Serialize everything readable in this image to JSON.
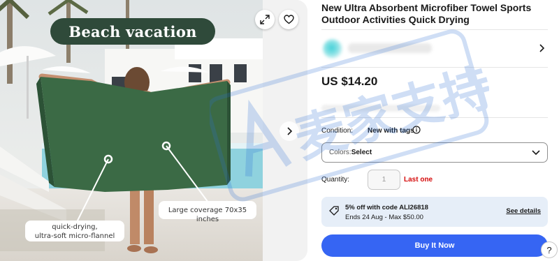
{
  "gallery": {
    "badge_text": "Beach vacation",
    "callouts": [
      "Large coverage 70x35 inches",
      "quick-drying,\nultra-soft micro-flannel"
    ],
    "expand_icon": "expand-icon",
    "favorite_icon": "heart-icon",
    "next_icon": "chevron-right-icon"
  },
  "product": {
    "title": "New Ultra Absorbent Microfiber Towel Sports Outdoor Activities Quick Drying",
    "price": "US $14.20",
    "condition_label": "Condition:",
    "condition_value": "New with tags",
    "variation": {
      "label": "Colors: ",
      "value": "Select"
    },
    "quantity_label": "Quantity:",
    "quantity_placeholder": "1",
    "stock_note": "Last one",
    "promo": {
      "line1": "5% off with code ALI26818",
      "line2": "Ends 24 Aug - Max $50.00",
      "link": "See details"
    },
    "buy_label": "Buy It Now"
  },
  "help_label": "?",
  "watermark_text": "麦家支持",
  "colors": {
    "accent": "#3665f3",
    "badge_bg": "#2f4a3a",
    "towel": "#3b6a45",
    "alert": "#d50b0b",
    "promo_bg": "#e6eef8"
  }
}
